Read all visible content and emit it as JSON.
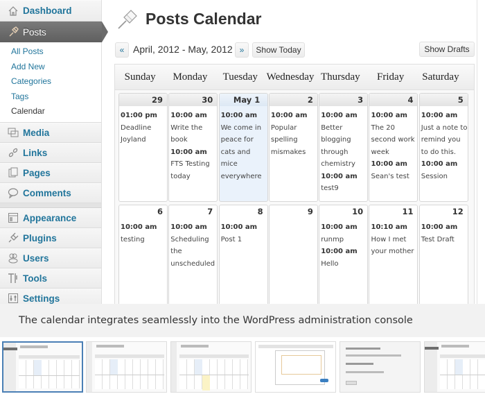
{
  "sidebar": {
    "items": [
      {
        "label": "Dashboard",
        "icon": "home-icon"
      },
      {
        "label": "Posts",
        "icon": "pushpin-icon",
        "active": true
      },
      {
        "label": "Media",
        "icon": "media-icon"
      },
      {
        "label": "Links",
        "icon": "link-icon"
      },
      {
        "label": "Pages",
        "icon": "pages-icon"
      },
      {
        "label": "Comments",
        "icon": "comment-icon"
      },
      {
        "label": "Appearance",
        "icon": "appearance-icon"
      },
      {
        "label": "Plugins",
        "icon": "plugin-icon"
      },
      {
        "label": "Users",
        "icon": "users-icon"
      },
      {
        "label": "Tools",
        "icon": "tools-icon"
      },
      {
        "label": "Settings",
        "icon": "settings-icon"
      }
    ],
    "posts_submenu": [
      {
        "label": "All Posts"
      },
      {
        "label": "Add New"
      },
      {
        "label": "Categories"
      },
      {
        "label": "Tags"
      },
      {
        "label": "Calendar",
        "current": true
      }
    ]
  },
  "header": {
    "title": "Posts Calendar",
    "icon": "pushpin-icon"
  },
  "nav": {
    "prev_label": "«",
    "range_label": "April, 2012 - May, 2012",
    "next_label": "»",
    "show_today_label": "Show Today",
    "show_drafts_label": "Show Drafts"
  },
  "calendar": {
    "day_headers": [
      "Sunday",
      "Monday",
      "Tuesday",
      "Wednesday",
      "Thursday",
      "Friday",
      "Saturday"
    ],
    "weeks": [
      [
        {
          "date": "29",
          "posts": [
            {
              "time": "01:00 pm",
              "title": "Deadline Joyland"
            }
          ]
        },
        {
          "date": "30",
          "posts": [
            {
              "time": "10:00 am",
              "title": "Write the book"
            },
            {
              "time": "10:00 am",
              "title": "FTS Testing today"
            }
          ]
        },
        {
          "date": "May 1",
          "today": true,
          "posts": [
            {
              "time": "10:00 am",
              "title": "We come in peace for cats and mice everywhere"
            }
          ]
        },
        {
          "date": "2",
          "posts": [
            {
              "time": "10:00 am",
              "title": "Popular spelling mismakes"
            }
          ]
        },
        {
          "date": "3",
          "posts": [
            {
              "time": "10:00 am",
              "title": "Better blogging through chemistry"
            },
            {
              "time": "10:00 am",
              "title": "test9"
            }
          ]
        },
        {
          "date": "4",
          "posts": [
            {
              "time": "10:00 am",
              "title": "The 20 second work week"
            },
            {
              "time": "10:00 am",
              "title": "Sean's test"
            }
          ]
        },
        {
          "date": "5",
          "posts": [
            {
              "time": "10:00 am",
              "title": "Just a note to remind you to do this."
            },
            {
              "time": "10:00 am",
              "title": "Session"
            }
          ]
        }
      ],
      [
        {
          "date": "6",
          "posts": [
            {
              "time": "10:00 am",
              "title": "testing"
            }
          ]
        },
        {
          "date": "7",
          "posts": [
            {
              "time": "10:00 am",
              "title": "Scheduling the unscheduled"
            }
          ]
        },
        {
          "date": "8",
          "posts": [
            {
              "time": "10:00 am",
              "title": "Post 1"
            }
          ]
        },
        {
          "date": "9",
          "posts": []
        },
        {
          "date": "10",
          "posts": [
            {
              "time": "10:00 am",
              "title": "runmp"
            },
            {
              "time": "10:00 am",
              "title": "Hello"
            }
          ]
        },
        {
          "date": "11",
          "posts": [
            {
              "time": "10:10 am",
              "title": "How I met your mother"
            }
          ]
        },
        {
          "date": "12",
          "posts": [
            {
              "time": "10:00 am",
              "title": "Test Draft"
            }
          ]
        }
      ]
    ]
  },
  "caption": "The calendar integrates seamlessly into the WordPress administration console",
  "thumbnails": [
    {
      "name": "screenshot-1",
      "active": true
    },
    {
      "name": "screenshot-2"
    },
    {
      "name": "screenshot-3"
    },
    {
      "name": "screenshot-4"
    },
    {
      "name": "screenshot-5"
    },
    {
      "name": "screenshot-6"
    }
  ],
  "colors": {
    "link": "#21759b",
    "active_menu": "#6b6b6b",
    "today_cell": "#eaf2fb",
    "active_thumb_border": "#4a7fb5"
  }
}
